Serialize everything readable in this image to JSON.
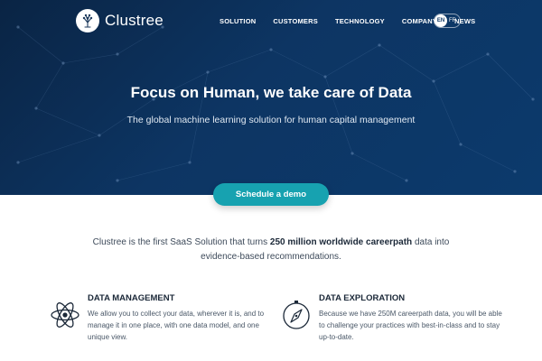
{
  "brand": {
    "name": "Clustree"
  },
  "nav": {
    "items": [
      {
        "label": "SOLUTION"
      },
      {
        "label": "CUSTOMERS"
      },
      {
        "label": "TECHNOLOGY"
      },
      {
        "label": "COMPANY"
      },
      {
        "label": "NEWS"
      }
    ]
  },
  "lang": {
    "active": "EN",
    "other": "FR"
  },
  "hero": {
    "title": "Focus on Human, we take care of Data",
    "subtitle": "The global machine learning solution for human capital management"
  },
  "cta": {
    "label": "Schedule a demo"
  },
  "intro": {
    "before": "Clustree is the first SaaS Solution that turns ",
    "highlight": "250 million worldwide careerpath",
    "after": " data into evidence-based recommendations."
  },
  "features": [
    {
      "title": "DATA MANAGEMENT",
      "text": "We allow you to collect your data, wherever it is, and to manage it in one place, with one data model, and one unique view.",
      "icon": "atom-icon"
    },
    {
      "title": "DATA EXPLORATION",
      "text": "Because we have 250M careerpath data, you will be able to challenge your practices with best-in-class and to stay up-to-date.",
      "icon": "compass-icon"
    }
  ],
  "colors": {
    "hero_dark": "#0a2444",
    "hero_mid": "#0d3563",
    "accent": "#17a2b0",
    "heading": "#1b2838"
  }
}
